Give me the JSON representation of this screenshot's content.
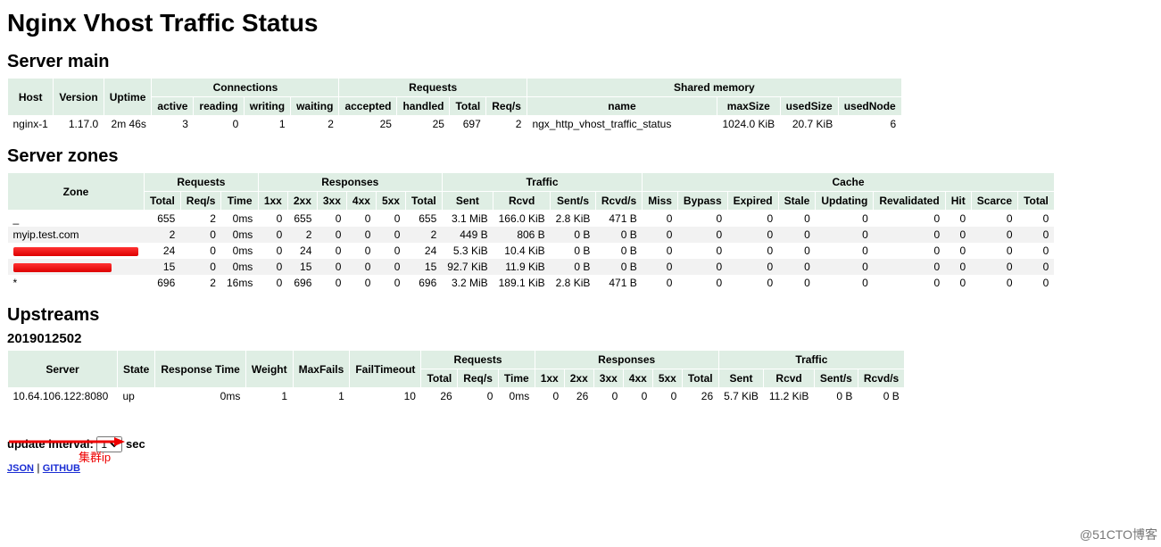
{
  "title": "Nginx Vhost Traffic Status",
  "sections": {
    "server_main": "Server main",
    "server_zones": "Server zones",
    "upstreams": "Upstreams"
  },
  "main_headers": {
    "host": "Host",
    "version": "Version",
    "uptime": "Uptime",
    "connections": "Connections",
    "active": "active",
    "reading": "reading",
    "writing": "writing",
    "waiting": "waiting",
    "requests": "Requests",
    "accepted": "accepted",
    "handled": "handled",
    "total": "Total",
    "reqs": "Req/s",
    "shared": "Shared memory",
    "name": "name",
    "maxsize": "maxSize",
    "usedsize": "usedSize",
    "usednode": "usedNode"
  },
  "main_row": {
    "host": "nginx-1",
    "version": "1.17.0",
    "uptime": "2m 46s",
    "active": "3",
    "reading": "0",
    "writing": "1",
    "waiting": "2",
    "accepted": "25",
    "handled": "25",
    "total": "697",
    "reqs": "2",
    "name": "ngx_http_vhost_traffic_status",
    "maxsize": "1024.0 KiB",
    "usedsize": "20.7 KiB",
    "usednode": "6"
  },
  "zone_headers": {
    "zone": "Zone",
    "requests": "Requests",
    "responses": "Responses",
    "traffic": "Traffic",
    "cache": "Cache",
    "total": "Total",
    "reqs": "Req/s",
    "time": "Time",
    "r1": "1xx",
    "r2": "2xx",
    "r3": "3xx",
    "r4": "4xx",
    "r5": "5xx",
    "rtotal": "Total",
    "sent": "Sent",
    "rcvd": "Rcvd",
    "sents": "Sent/s",
    "rcvds": "Rcvd/s",
    "miss": "Miss",
    "bypass": "Bypass",
    "expired": "Expired",
    "stale": "Stale",
    "updating": "Updating",
    "reval": "Revalidated",
    "hit": "Hit",
    "scarce": "Scarce",
    "ctotal": "Total"
  },
  "zones": [
    {
      "zone": "_",
      "total": "655",
      "reqs": "2",
      "time": "0ms",
      "r1": "0",
      "r2": "655",
      "r3": "0",
      "r4": "0",
      "r5": "0",
      "rtotal": "655",
      "sent": "3.1 MiB",
      "rcvd": "166.0 KiB",
      "sents": "2.8 KiB",
      "rcvds": "471 B",
      "miss": "0",
      "bypass": "0",
      "expired": "0",
      "stale": "0",
      "updating": "0",
      "reval": "0",
      "hit": "0",
      "scarce": "0",
      "ctotal": "0",
      "redact1": false,
      "redact2": false
    },
    {
      "zone": "myip.test.com",
      "total": "2",
      "reqs": "0",
      "time": "0ms",
      "r1": "0",
      "r2": "2",
      "r3": "0",
      "r4": "0",
      "r5": "0",
      "rtotal": "2",
      "sent": "449 B",
      "rcvd": "806 B",
      "sents": "0 B",
      "rcvds": "0 B",
      "miss": "0",
      "bypass": "0",
      "expired": "0",
      "stale": "0",
      "updating": "0",
      "reval": "0",
      "hit": "0",
      "scarce": "0",
      "ctotal": "0",
      "redact1": false,
      "redact2": false
    },
    {
      "zone": "",
      "total": "24",
      "reqs": "0",
      "time": "0ms",
      "r1": "0",
      "r2": "24",
      "r3": "0",
      "r4": "0",
      "r5": "0",
      "rtotal": "24",
      "sent": "5.3 KiB",
      "rcvd": "10.4 KiB",
      "sents": "0 B",
      "rcvds": "0 B",
      "miss": "0",
      "bypass": "0",
      "expired": "0",
      "stale": "0",
      "updating": "0",
      "reval": "0",
      "hit": "0",
      "scarce": "0",
      "ctotal": "0",
      "redact1": true,
      "redact2": false
    },
    {
      "zone": "",
      "total": "15",
      "reqs": "0",
      "time": "0ms",
      "r1": "0",
      "r2": "15",
      "r3": "0",
      "r4": "0",
      "r5": "0",
      "rtotal": "15",
      "sent": "92.7 KiB",
      "rcvd": "11.9 KiB",
      "sents": "0 B",
      "rcvds": "0 B",
      "miss": "0",
      "bypass": "0",
      "expired": "0",
      "stale": "0",
      "updating": "0",
      "reval": "0",
      "hit": "0",
      "scarce": "0",
      "ctotal": "0",
      "redact1": false,
      "redact2": true
    },
    {
      "zone": "*",
      "total": "696",
      "reqs": "2",
      "time": "16ms",
      "r1": "0",
      "r2": "696",
      "r3": "0",
      "r4": "0",
      "r5": "0",
      "rtotal": "696",
      "sent": "3.2 MiB",
      "rcvd": "189.1 KiB",
      "sents": "2.8 KiB",
      "rcvds": "471 B",
      "miss": "0",
      "bypass": "0",
      "expired": "0",
      "stale": "0",
      "updating": "0",
      "reval": "0",
      "hit": "0",
      "scarce": "0",
      "ctotal": "0",
      "redact1": false,
      "redact2": false
    }
  ],
  "upstream_group": "2019012502",
  "up_headers": {
    "server": "Server",
    "state": "State",
    "resptime": "Response Time",
    "weight": "Weight",
    "maxfails": "MaxFails",
    "failtimeout": "FailTimeout",
    "requests": "Requests",
    "total": "Total",
    "reqs": "Req/s",
    "time": "Time",
    "responses": "Responses",
    "r1": "1xx",
    "r2": "2xx",
    "r3": "3xx",
    "r4": "4xx",
    "r5": "5xx",
    "rtotal": "Total",
    "traffic": "Traffic",
    "sent": "Sent",
    "rcvd": "Rcvd",
    "sents": "Sent/s",
    "rcvds": "Rcvd/s"
  },
  "up_row": {
    "server": "10.64.106.122:8080",
    "state": "up",
    "resptime": "0ms",
    "weight": "1",
    "maxfails": "1",
    "failtimeout": "10",
    "total": "26",
    "reqs": "0",
    "time": "0ms",
    "r1": "0",
    "r2": "26",
    "r3": "0",
    "r4": "0",
    "r5": "0",
    "rtotal": "26",
    "sent": "5.7 KiB",
    "rcvd": "11.2 KiB",
    "sents": "0 B",
    "rcvds": "0 B"
  },
  "annotation": "集群ip",
  "update_label": "update interval:",
  "update_value": "1",
  "update_suffix": "sec",
  "links": {
    "json": "JSON",
    "sep": "|",
    "github": "GITHUB"
  },
  "watermark": "@51CTO博客"
}
